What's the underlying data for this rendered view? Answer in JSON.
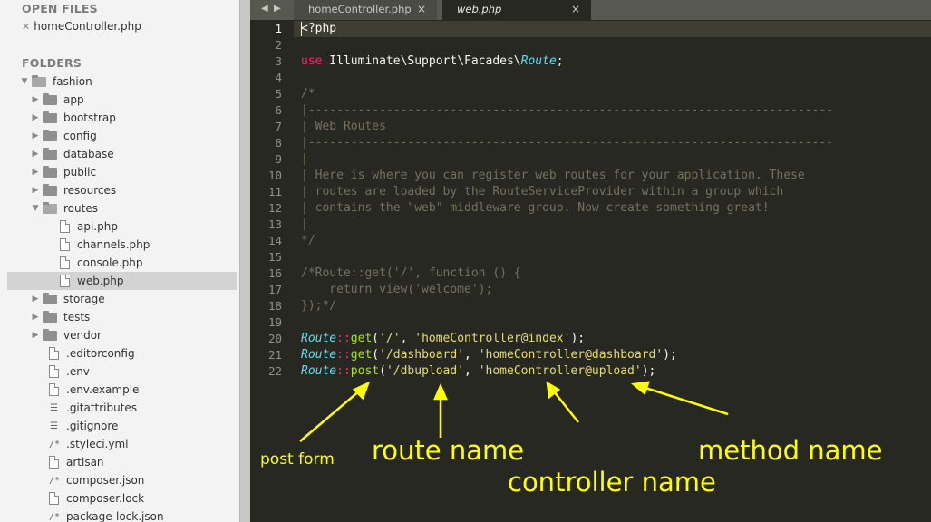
{
  "sidebar": {
    "open_files_header": "OPEN FILES",
    "open_files": [
      "homeController.php"
    ],
    "folders_header": "FOLDERS",
    "tree": [
      {
        "label": "fashion",
        "type": "folder",
        "open": true,
        "depth": 0
      },
      {
        "label": "app",
        "type": "folder",
        "open": false,
        "depth": 1
      },
      {
        "label": "bootstrap",
        "type": "folder",
        "open": false,
        "depth": 1
      },
      {
        "label": "config",
        "type": "folder",
        "open": false,
        "depth": 1
      },
      {
        "label": "database",
        "type": "folder",
        "open": false,
        "depth": 1
      },
      {
        "label": "public",
        "type": "folder",
        "open": false,
        "depth": 1
      },
      {
        "label": "resources",
        "type": "folder",
        "open": false,
        "depth": 1
      },
      {
        "label": "routes",
        "type": "folder",
        "open": true,
        "depth": 1
      },
      {
        "label": "api.php",
        "type": "file",
        "depth": 2
      },
      {
        "label": "channels.php",
        "type": "file",
        "depth": 2
      },
      {
        "label": "console.php",
        "type": "file",
        "depth": 2
      },
      {
        "label": "web.php",
        "type": "file",
        "depth": 2,
        "selected": true
      },
      {
        "label": "storage",
        "type": "folder",
        "open": false,
        "depth": 1
      },
      {
        "label": "tests",
        "type": "folder",
        "open": false,
        "depth": 1
      },
      {
        "label": "vendor",
        "type": "folder",
        "open": false,
        "depth": 1
      },
      {
        "label": ".editorconfig",
        "type": "file",
        "depth": 1
      },
      {
        "label": ".env",
        "type": "file",
        "depth": 1
      },
      {
        "label": ".env.example",
        "type": "file",
        "depth": 1
      },
      {
        "label": ".gitattributes",
        "type": "lines",
        "depth": 1
      },
      {
        "label": ".gitignore",
        "type": "lines",
        "depth": 1
      },
      {
        "label": ".styleci.yml",
        "type": "comment",
        "depth": 1
      },
      {
        "label": "artisan",
        "type": "file",
        "depth": 1
      },
      {
        "label": "composer.json",
        "type": "comment",
        "depth": 1
      },
      {
        "label": "composer.lock",
        "type": "file",
        "depth": 1
      },
      {
        "label": "package-lock.json",
        "type": "comment",
        "depth": 1
      }
    ]
  },
  "tabs": {
    "nav_prev": "◀",
    "nav_next": "▶",
    "items": [
      {
        "label": "homeController.php",
        "active": false,
        "close": "×"
      },
      {
        "label": "web.php",
        "active": true,
        "close": "×"
      }
    ]
  },
  "editor": {
    "active_line": 1,
    "lines": [
      [
        {
          "t": "<?php",
          "c": "tag"
        }
      ],
      [],
      [
        {
          "t": "use",
          "c": "kw"
        },
        {
          "t": " Illuminate\\Support\\Facades\\",
          "c": ""
        },
        {
          "t": "Route",
          "c": "cls"
        },
        {
          "t": ";",
          "c": ""
        }
      ],
      [],
      [
        {
          "t": "/*",
          "c": "cm"
        }
      ],
      [
        {
          "t": "|--------------------------------------------------------------------------",
          "c": "cm"
        }
      ],
      [
        {
          "t": "| Web Routes",
          "c": "cm"
        }
      ],
      [
        {
          "t": "|--------------------------------------------------------------------------",
          "c": "cm"
        }
      ],
      [
        {
          "t": "|",
          "c": "cm"
        }
      ],
      [
        {
          "t": "| Here is where you can register web routes for your application. These",
          "c": "cm"
        }
      ],
      [
        {
          "t": "| routes are loaded by the RouteServiceProvider within a group which",
          "c": "cm"
        }
      ],
      [
        {
          "t": "| contains the \"web\" middleware group. Now create something great!",
          "c": "cm"
        }
      ],
      [
        {
          "t": "|",
          "c": "cm"
        }
      ],
      [
        {
          "t": "*/",
          "c": "cm"
        }
      ],
      [],
      [
        {
          "t": "/*Route::get('/', function () {",
          "c": "cm"
        }
      ],
      [
        {
          "t": "    return view('welcome');",
          "c": "cm"
        }
      ],
      [
        {
          "t": "});*/",
          "c": "cm"
        }
      ],
      [],
      [
        {
          "t": "Route",
          "c": "cls"
        },
        {
          "t": "::",
          "c": "kw"
        },
        {
          "t": "get",
          "c": "fn"
        },
        {
          "t": "(",
          "c": ""
        },
        {
          "t": "'/'",
          "c": "str"
        },
        {
          "t": ", ",
          "c": ""
        },
        {
          "t": "'homeController@index'",
          "c": "str"
        },
        {
          "t": ");",
          "c": ""
        }
      ],
      [
        {
          "t": "Route",
          "c": "cls"
        },
        {
          "t": "::",
          "c": "kw"
        },
        {
          "t": "get",
          "c": "fn"
        },
        {
          "t": "(",
          "c": ""
        },
        {
          "t": "'/dashboard'",
          "c": "str"
        },
        {
          "t": ", ",
          "c": ""
        },
        {
          "t": "'homeController@dashboard'",
          "c": "str"
        },
        {
          "t": ");",
          "c": ""
        }
      ],
      [
        {
          "t": "Route",
          "c": "cls"
        },
        {
          "t": "::",
          "c": "kw"
        },
        {
          "t": "post",
          "c": "fn"
        },
        {
          "t": "(",
          "c": ""
        },
        {
          "t": "'/dbupload'",
          "c": "str"
        },
        {
          "t": ", ",
          "c": ""
        },
        {
          "t": "'homeController@upload'",
          "c": "str"
        },
        {
          "t": ");",
          "c": ""
        }
      ]
    ]
  },
  "annotations": {
    "color": "#ffff00",
    "post_form": "post form",
    "route_name": "route name",
    "controller_name": "controller name",
    "method_name": "method name"
  },
  "colors": {
    "editor_bg": "#272822",
    "keyword": "#f92672",
    "class": "#66d9ef",
    "function": "#a6e22e",
    "string": "#e6db74",
    "comment": "#75715e"
  }
}
